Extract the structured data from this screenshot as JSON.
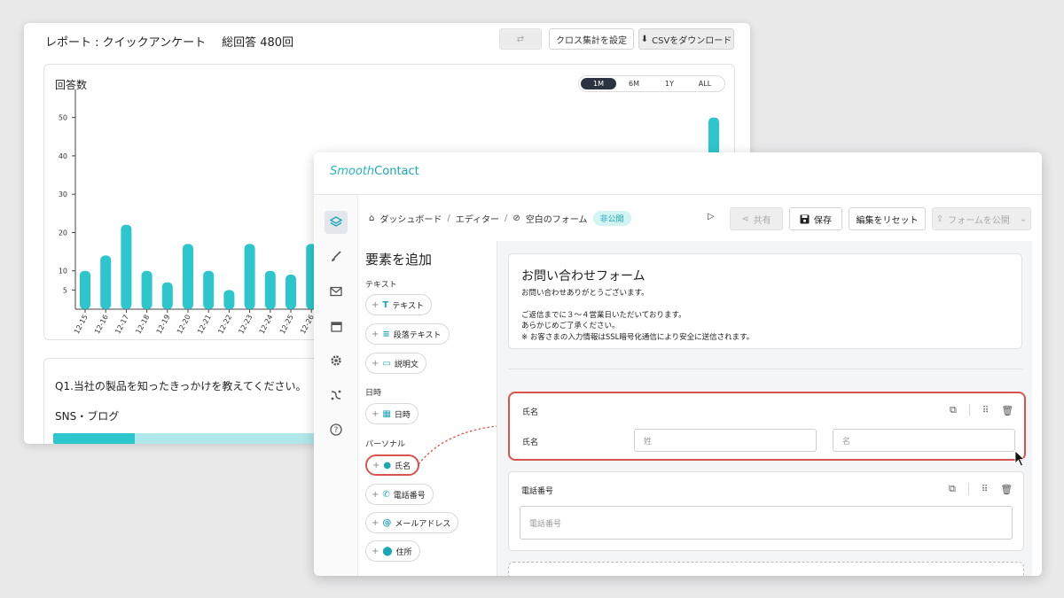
{
  "report": {
    "title": "レポート : クイックアンケート",
    "total": "総回答 480回",
    "cross_label": "クロス集計を設定",
    "csv_label": "CSVをダウンロード",
    "chart_title": "回答数",
    "ranges": [
      "1M",
      "6M",
      "1Y",
      "ALL"
    ],
    "active_range": "1M",
    "question": "Q1.当社の製品を知ったきっかけを教えてください。",
    "option": "SNS・ブログ",
    "option_share": 0.12
  },
  "chart_data": {
    "type": "bar",
    "categories": [
      "12-15",
      "12-16",
      "12-17",
      "12-18",
      "12-19",
      "12-20",
      "12-21",
      "12-22",
      "12-23",
      "12-24",
      "12-25",
      "12-26"
    ],
    "values": [
      10,
      14,
      22,
      10,
      7,
      17,
      10,
      5,
      17,
      10,
      9,
      17
    ],
    "extra_bar_value": 50,
    "yticks": [
      5,
      10,
      20,
      30,
      40,
      50
    ],
    "ylim": [
      0,
      55
    ],
    "colors": {
      "bar": "#2cc6cc"
    }
  },
  "editor": {
    "logo_a": "Smooth",
    "logo_b": "Contact",
    "crumbs": [
      "ダッシュボード",
      "エディター",
      "空白のフォーム"
    ],
    "crumb_sep": "/",
    "status_badge": "非公開",
    "share_label": "共有",
    "save_label": "保存",
    "reset_label": "編集をリセット",
    "publish_label": "フォームを公開",
    "panel_title": "要素を追加",
    "sections": {
      "text": "テキスト",
      "datetime": "日時",
      "personal": "パーソナル"
    },
    "chips": {
      "text": "テキスト",
      "paragraph": "段落テキスト",
      "description": "説明文",
      "date": "日時",
      "name": "氏名",
      "phone": "電話番号",
      "email": "メールアドレス",
      "address": "住所"
    },
    "form": {
      "title": "お問い合わせフォーム",
      "line1": "お問い合わせありがとうございます。",
      "line2": "ご返信までに３〜４営業日いただいております。",
      "line3": "あらかじめご了承ください。",
      "line4": "※ お客さまの入力情報はSSL暗号化通信により安全に送信されます。",
      "name_card_title": "氏名",
      "name_label": "氏名",
      "last_placeholder": "姓",
      "first_placeholder": "名",
      "phone_card_title": "電話番号",
      "phone_placeholder": "電話番号"
    }
  }
}
